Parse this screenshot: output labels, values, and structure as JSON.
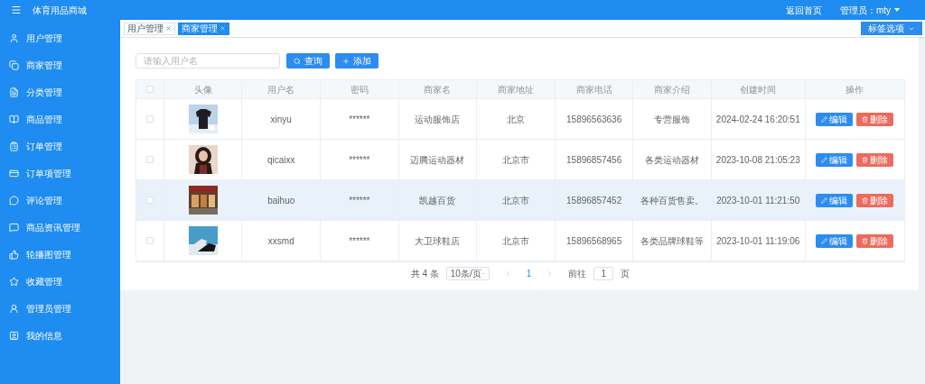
{
  "header": {
    "title": "体育用品商城",
    "home_link": "返回首页",
    "user_menu": "管理员：mty"
  },
  "sidebar": {
    "items": [
      {
        "label": "用户管理"
      },
      {
        "label": "商家管理"
      },
      {
        "label": "分类管理"
      },
      {
        "label": "商品管理"
      },
      {
        "label": "订单管理"
      },
      {
        "label": "订单项管理"
      },
      {
        "label": "评论管理"
      },
      {
        "label": "商品资讯管理"
      },
      {
        "label": "轮播图管理"
      },
      {
        "label": "收藏管理"
      },
      {
        "label": "管理员管理"
      },
      {
        "label": "我的信息"
      }
    ]
  },
  "tabs": [
    {
      "label": "用户管理",
      "selected": false
    },
    {
      "label": "商家管理",
      "selected": true
    }
  ],
  "tab_options": "标签选项",
  "search": {
    "placeholder": "请输入用户名",
    "query_button": "查询",
    "add_button": "添加"
  },
  "table": {
    "select_all": {
      "checked": false
    },
    "columns": [
      "头像",
      "用户名",
      "密码",
      "商家名",
      "商家地址",
      "商家电话",
      "商家介绍",
      "创建时间",
      "操作"
    ],
    "rows": [
      {
        "checked": false,
        "highlighted": false,
        "username": "xinyu",
        "password": "******",
        "shop_name": "运动服饰店",
        "address": "北京",
        "phone": "15896563636",
        "intro": "专营服饰",
        "created": "2024-02-24 16:20:51",
        "edit": "编辑",
        "delete": "删除"
      },
      {
        "checked": false,
        "highlighted": false,
        "username": "qicaixx",
        "password": "******",
        "shop_name": "迈腾运动器材",
        "address": "北京市",
        "phone": "15896857456",
        "intro": "各类运动器材",
        "created": "2023-10-08 21:05:23",
        "edit": "编辑",
        "delete": "删除"
      },
      {
        "checked": false,
        "highlighted": true,
        "username": "baihuo",
        "password": "******",
        "shop_name": "凯越百货",
        "address": "北京市",
        "phone": "15896857452",
        "intro": "各种百货售卖。",
        "created": "2023-10-01 11:21:50",
        "edit": "编辑",
        "delete": "删除"
      },
      {
        "checked": false,
        "highlighted": false,
        "username": "xxsmd",
        "password": "******",
        "shop_name": "大卫球鞋店",
        "address": "北京市",
        "phone": "15896568965",
        "intro": "各类品牌球鞋等",
        "created": "2023-10-01 11:19:06",
        "edit": "编辑",
        "delete": "删除"
      }
    ]
  },
  "pagination": {
    "total": "共 4 条",
    "page_size": "10条/页",
    "pages": [
      {
        "label": "1",
        "selected": true
      }
    ],
    "goto_label": "前往",
    "goto_value": "1",
    "goto_suffix": "页"
  }
}
